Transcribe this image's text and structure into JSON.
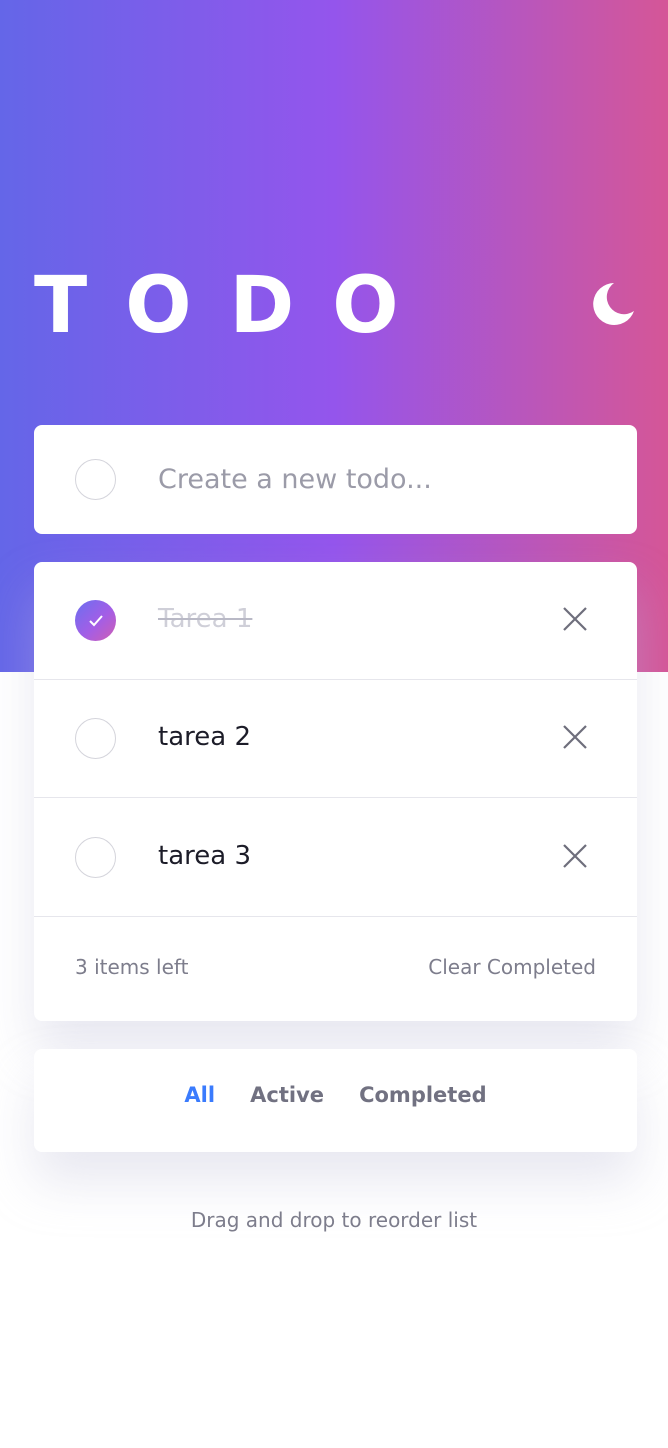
{
  "header": {
    "title": "TODO",
    "theme_toggle_icon": "moon-icon"
  },
  "new_todo": {
    "placeholder": "Create a new todo..."
  },
  "todos": [
    {
      "text": "Tarea 1",
      "completed": true
    },
    {
      "text": "tarea 2",
      "completed": false
    },
    {
      "text": "tarea 3",
      "completed": false
    }
  ],
  "footer": {
    "items_left": "3 items left",
    "clear_completed": "Clear Completed"
  },
  "filters": {
    "all": "All",
    "active": "Active",
    "completed": "Completed",
    "selected": "All"
  },
  "hint": "Drag and drop to reorder list",
  "colors": {
    "gradient_start": "#6466e8",
    "gradient_mid": "#9455ec",
    "gradient_end": "#d55697",
    "active_filter": "#3a7bfd"
  }
}
